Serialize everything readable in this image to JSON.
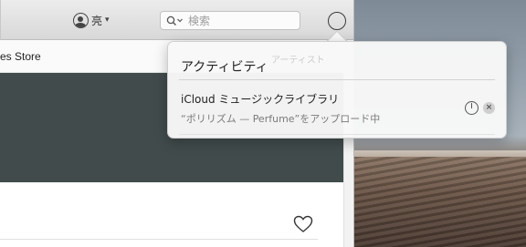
{
  "toolbar": {
    "account_label": "亮",
    "search_placeholder": "検索"
  },
  "store": {
    "title": "es Store"
  },
  "activity": {
    "title": "アクティビティ",
    "faint_text": "アーティスト",
    "items": [
      {
        "name": "iCloud ミュージックライブラリ",
        "status": "“ポリリズム — Perfume”をアップロード中"
      }
    ]
  },
  "colors": {
    "hero": "#414b4b",
    "toolbar": "#e2e2e2",
    "popover": "#f8f8f8"
  },
  "icons": [
    "user-icon",
    "chevron-down-icon",
    "search-icon",
    "activity-icon",
    "progress-icon",
    "cancel-icon",
    "heart-icon"
  ]
}
